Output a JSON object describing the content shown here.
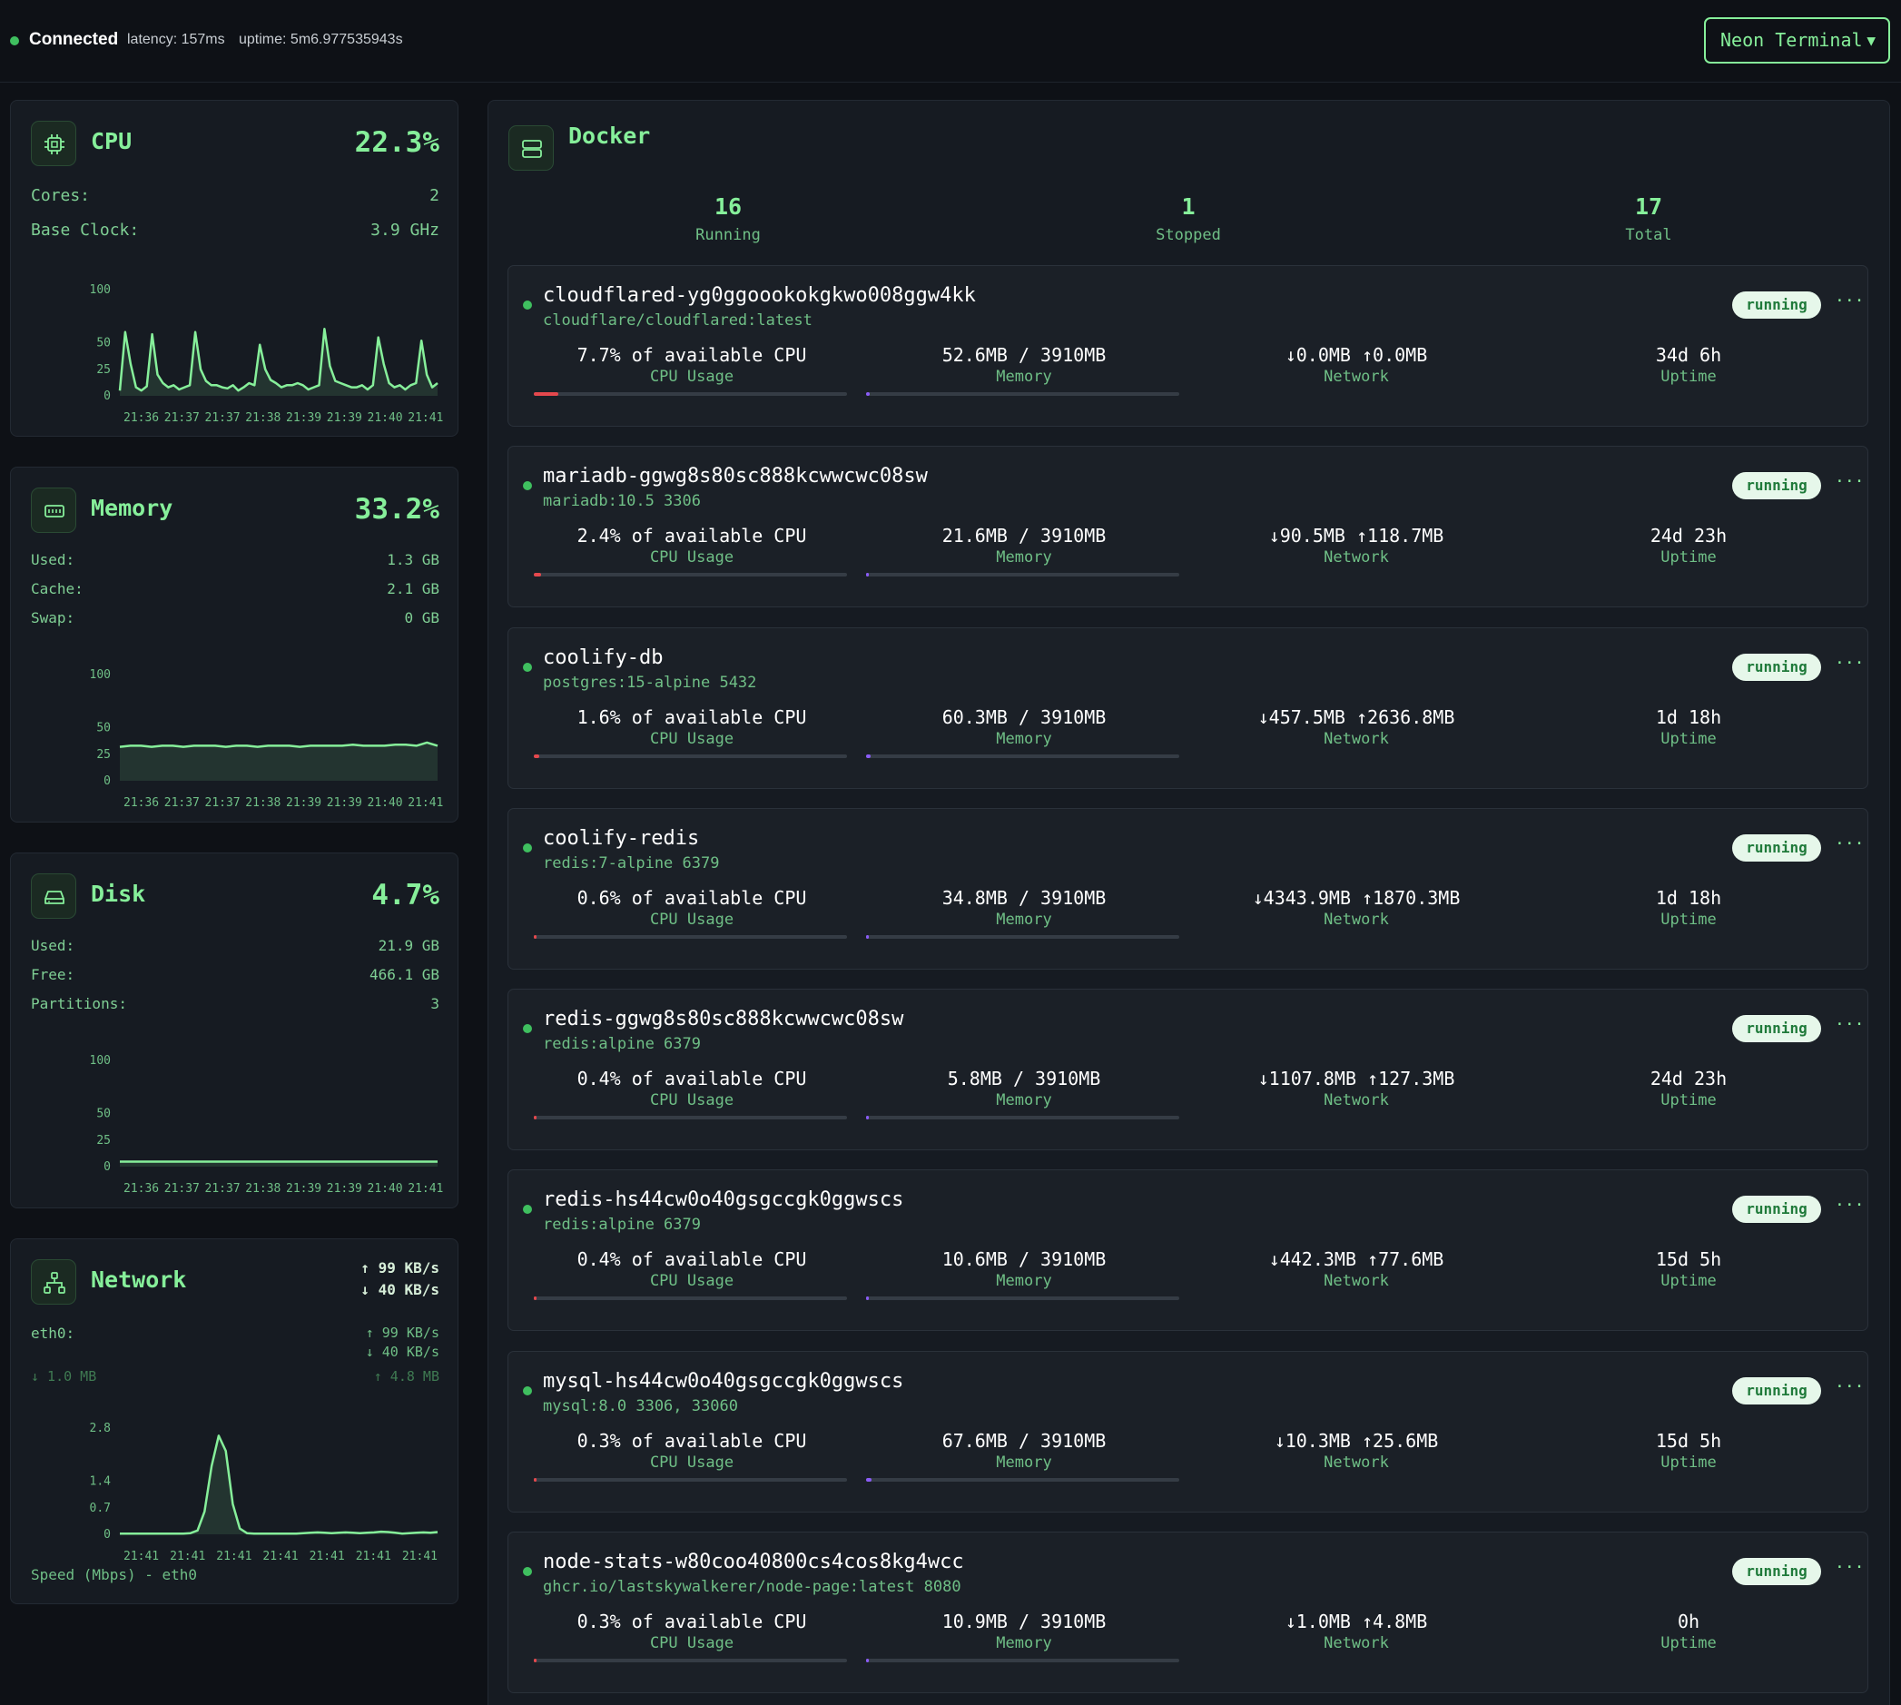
{
  "topbar": {
    "status": "Connected",
    "latency": "latency: 157ms",
    "uptime": "uptime: 5m6.977535943s",
    "theme_button": "Neon Terminal",
    "caret": "▼"
  },
  "cpu": {
    "title": "CPU",
    "value": "22.3%",
    "rows": [
      {
        "label": "Cores:",
        "value": "2"
      },
      {
        "label": "Base Clock:",
        "value": "3.9 GHz"
      }
    ]
  },
  "memory": {
    "title": "Memory",
    "value": "33.2%",
    "rows": [
      {
        "label": "Used:",
        "value": "1.3 GB"
      },
      {
        "label": "Cache:",
        "value": "2.1 GB"
      },
      {
        "label": "Swap:",
        "value": "0 GB"
      }
    ]
  },
  "disk": {
    "title": "Disk",
    "value": "4.7%",
    "rows": [
      {
        "label": "Used:",
        "value": "21.9 GB"
      },
      {
        "label": "Free:",
        "value": "466.1 GB"
      },
      {
        "label": "Partitions:",
        "value": "3"
      }
    ]
  },
  "network": {
    "title": "Network",
    "up": "↑ 99 KB/s",
    "down": "↓ 40 KB/s",
    "iface": "eth0:",
    "iface_up": "↑ 99 KB/s",
    "iface_down": "↓ 40 KB/s",
    "total_down": "↓ 1.0 MB",
    "total_up": "↑ 4.8 MB",
    "caption": "Speed (Mbps) - eth0"
  },
  "chart_data": [
    {
      "type": "area",
      "title": "",
      "yticks": [
        "100",
        "50",
        "25",
        "0"
      ],
      "ylim": [
        0,
        100
      ],
      "xticks": [
        "21:36",
        "21:37",
        "21:37",
        "21:38",
        "21:39",
        "21:39",
        "21:40",
        "21:41"
      ],
      "values": [
        5,
        60,
        30,
        8,
        5,
        9,
        58,
        20,
        12,
        8,
        10,
        6,
        8,
        10,
        60,
        25,
        14,
        10,
        10,
        8,
        7,
        10,
        5,
        8,
        12,
        10,
        48,
        25,
        15,
        12,
        8,
        10,
        10,
        12,
        10,
        6,
        8,
        10,
        63,
        28,
        14,
        12,
        10,
        8,
        8,
        10,
        6,
        10,
        55,
        30,
        12,
        8,
        10,
        6,
        10,
        12,
        52,
        20,
        8,
        12
      ]
    },
    {
      "type": "area",
      "title": "",
      "yticks": [
        "100",
        "50",
        "25",
        "0"
      ],
      "ylim": [
        0,
        100
      ],
      "xticks": [
        "21:36",
        "21:37",
        "21:37",
        "21:38",
        "21:39",
        "21:39",
        "21:40",
        "21:41"
      ],
      "values": [
        32,
        33,
        33,
        32,
        33,
        33,
        32,
        33,
        33,
        33,
        32,
        33,
        33,
        32,
        33,
        33,
        33,
        32,
        33,
        33,
        33,
        33,
        34,
        33,
        33,
        33,
        34,
        34,
        33,
        36,
        33
      ]
    },
    {
      "type": "area",
      "title": "",
      "yticks": [
        "100",
        "50",
        "25",
        "0"
      ],
      "ylim": [
        0,
        100
      ],
      "xticks": [
        "21:36",
        "21:37",
        "21:37",
        "21:38",
        "21:39",
        "21:39",
        "21:40",
        "21:41"
      ],
      "values": [
        4.7,
        4.7,
        4.7,
        4.7,
        4.7,
        4.7,
        4.7,
        4.7,
        4.7,
        4.7,
        4.7,
        4.7
      ]
    },
    {
      "type": "area",
      "title": "",
      "yticks": [
        "2.8",
        "1.4",
        "0.7",
        "0"
      ],
      "ylim": [
        0,
        2.8
      ],
      "xticks": [
        "21:41",
        "21:41",
        "21:41",
        "21:41",
        "21:41",
        "21:41",
        "21:41"
      ],
      "values": [
        0.02,
        0.02,
        0.02,
        0.02,
        0.02,
        0.02,
        0.02,
        0.02,
        0.02,
        0.02,
        0.03,
        0.1,
        0.6,
        1.8,
        2.6,
        2.2,
        0.8,
        0.15,
        0.03,
        0.02,
        0.02,
        0.02,
        0.02,
        0.02,
        0.02,
        0.02,
        0.03,
        0.04,
        0.05,
        0.04,
        0.03,
        0.04,
        0.05,
        0.04,
        0.03,
        0.04,
        0.05,
        0.07,
        0.06,
        0.04,
        0.02,
        0.03,
        0.04,
        0.05,
        0.04,
        0.06
      ]
    }
  ],
  "docker": {
    "title": "Docker",
    "running": "16",
    "running_label": "Running",
    "stopped": "1",
    "stopped_label": "Stopped",
    "total": "17",
    "total_label": "Total",
    "cpu_label": "CPU Usage",
    "mem_label": "Memory",
    "net_label": "Network",
    "uptime_label": "Uptime",
    "status": "running",
    "more": "···",
    "containers": [
      {
        "name": "cloudflared-yg0ggoookokgkwo008ggw4kk",
        "image": "cloudflare/cloudflared:latest",
        "cpu": "7.7% of available CPU",
        "cpu_pct": 7.7,
        "mem": "52.6MB / 3910MB",
        "mem_pct": 1.3,
        "net": "↓0.0MB ↑0.0MB",
        "uptime": "34d 6h"
      },
      {
        "name": "mariadb-ggwg8s80sc888kcwwcwc08sw",
        "image": "mariadb:10.5 3306",
        "cpu": "2.4% of available CPU",
        "cpu_pct": 2.4,
        "mem": "21.6MB / 3910MB",
        "mem_pct": 0.6,
        "net": "↓90.5MB ↑118.7MB",
        "uptime": "24d 23h"
      },
      {
        "name": "coolify-db",
        "image": "postgres:15-alpine 5432",
        "cpu": "1.6% of available CPU",
        "cpu_pct": 1.6,
        "mem": "60.3MB / 3910MB",
        "mem_pct": 1.5,
        "net": "↓457.5MB ↑2636.8MB",
        "uptime": "1d 18h"
      },
      {
        "name": "coolify-redis",
        "image": "redis:7-alpine 6379",
        "cpu": "0.6% of available CPU",
        "cpu_pct": 0.6,
        "mem": "34.8MB / 3910MB",
        "mem_pct": 0.9,
        "net": "↓4343.9MB ↑1870.3MB",
        "uptime": "1d 18h"
      },
      {
        "name": "redis-ggwg8s80sc888kcwwcwc08sw",
        "image": "redis:alpine 6379",
        "cpu": "0.4% of available CPU",
        "cpu_pct": 0.4,
        "mem": "5.8MB / 3910MB",
        "mem_pct": 0.2,
        "net": "↓1107.8MB ↑127.3MB",
        "uptime": "24d 23h"
      },
      {
        "name": "redis-hs44cw0o40gsgccgk0ggwscs",
        "image": "redis:alpine 6379",
        "cpu": "0.4% of available CPU",
        "cpu_pct": 0.4,
        "mem": "10.6MB / 3910MB",
        "mem_pct": 0.3,
        "net": "↓442.3MB ↑77.6MB",
        "uptime": "15d 5h"
      },
      {
        "name": "mysql-hs44cw0o40gsgccgk0ggwscs",
        "image": "mysql:8.0 3306, 33060",
        "cpu": "0.3% of available CPU",
        "cpu_pct": 0.3,
        "mem": "67.6MB / 3910MB",
        "mem_pct": 1.7,
        "net": "↓10.3MB ↑25.6MB",
        "uptime": "15d 5h"
      },
      {
        "name": "node-stats-w80coo40800cs4cos8kg4wcc",
        "image": "ghcr.io/lastskywalkerer/node-page:latest 8080",
        "cpu": "0.3% of available CPU",
        "cpu_pct": 0.3,
        "mem": "10.9MB / 3910MB",
        "mem_pct": 0.3,
        "net": "↓1.0MB ↑4.8MB",
        "uptime": "0h"
      }
    ]
  },
  "colors": {
    "accent": "#86ef9a",
    "cpu_bar": "#e5484d",
    "mem_bar": "#8b5cf6",
    "status_green": "#3fbf5f"
  }
}
